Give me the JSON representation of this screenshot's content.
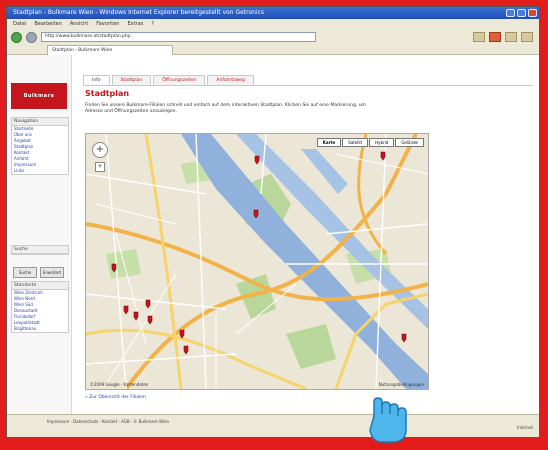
{
  "browser": {
    "title": "Stadtplan - Bulkmare Wien - Windows Internet Explorer bereitgestellt von Getronics",
    "menu": [
      "Datei",
      "Bearbeiten",
      "Ansicht",
      "Favoriten",
      "Extras",
      "?"
    ],
    "address": "http://www.bulkmare.at/stadtplan.php",
    "tab_label": "Stadtplan - Bulkmare Wien"
  },
  "site": {
    "logo_text": "Bulkmare"
  },
  "sidebar": {
    "box1_title": "Navigation",
    "box1_links": [
      "Startseite",
      "Über uns",
      "Angebot",
      "Stadtplan",
      "Kontakt",
      "Anfahrt",
      "Impressum",
      "Links"
    ],
    "box2_title": "Suche",
    "search_buttons": [
      "Suche",
      "Erweitert"
    ],
    "box3_title": "Standorte",
    "box3_links": [
      "Wien Zentrum",
      "Wien Nord",
      "Wien Süd",
      "Donaustadt",
      "Floridsdorf",
      "Leopoldstadt",
      "Brigittenau"
    ]
  },
  "page": {
    "tabs": [
      "Info",
      "Stadtplan",
      "Öffnungszeiten",
      "Anfahrtsweg"
    ],
    "title": "Stadtplan",
    "intro": "Finden Sie unsere Bulkmare-Filialen schnell und einfach auf dem interaktiven Stadtplan. Klicken Sie auf eine Markierung, um Adresse und Öffnungszeiten anzuzeigen.",
    "bottom_link": "» Zur Übersicht der Filialen"
  },
  "map": {
    "types": [
      "Karte",
      "Satellit",
      "Hybrid",
      "Gelände"
    ],
    "credit": "©2009 Google - Kartendaten",
    "terms": "Nutzungsbedingungen",
    "zoom_label": "+"
  },
  "footer": {
    "text": "Impressum · Datenschutz · Kontakt · AGB · © Bulkmare Wien",
    "status": "Internet"
  },
  "colors": {
    "brand_red": "#c4161c",
    "frame_red": "#e21b1b"
  }
}
